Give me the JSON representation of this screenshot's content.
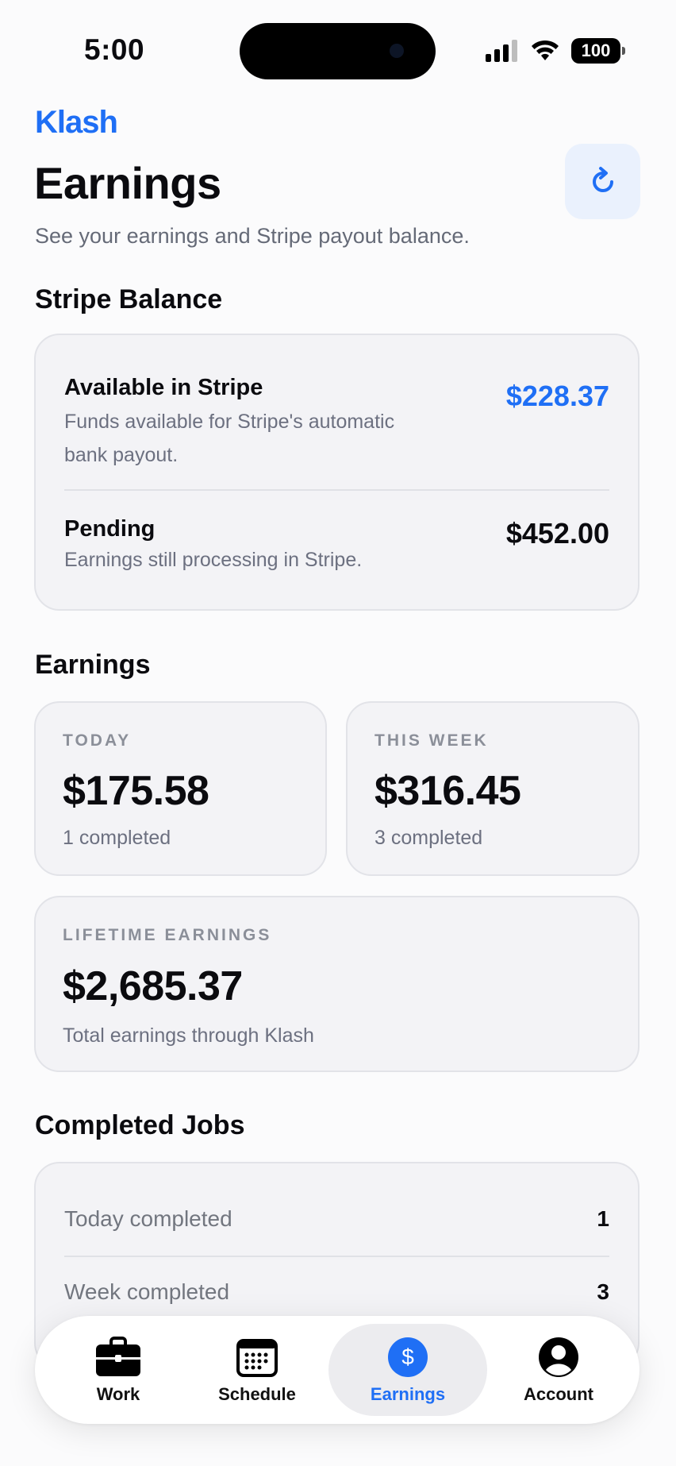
{
  "status_bar": {
    "time": "5:00",
    "battery": "100"
  },
  "header": {
    "brand": "Klash",
    "title": "Earnings",
    "subtitle": "See your earnings and Stripe payout balance.",
    "refresh_icon": "refresh-icon"
  },
  "stripe": {
    "section_title": "Stripe Balance",
    "available": {
      "title": "Available in Stripe",
      "desc_line1": "Funds available for Stripe's automatic",
      "desc_line2": "bank payout.",
      "amount": "$228.37"
    },
    "pending": {
      "title": "Pending",
      "desc": "Earnings still processing in Stripe.",
      "amount": "$452.00"
    }
  },
  "earnings": {
    "section_title": "Earnings",
    "today": {
      "label": "TODAY",
      "amount": "$175.58",
      "meta": "1 completed"
    },
    "week": {
      "label": "THIS WEEK",
      "amount": "$316.45",
      "meta": "3 completed"
    },
    "lifetime": {
      "label": "LIFETIME EARNINGS",
      "amount": "$2,685.37",
      "meta": "Total earnings through Klash"
    }
  },
  "completed_jobs": {
    "section_title": "Completed Jobs",
    "rows": [
      {
        "label": "Today completed",
        "count": "1"
      },
      {
        "label": "Week completed",
        "count": "3"
      }
    ]
  },
  "tab_bar": {
    "tabs": [
      {
        "label": "Work",
        "icon": "briefcase-icon"
      },
      {
        "label": "Schedule",
        "icon": "calendar-icon"
      },
      {
        "label": "Earnings",
        "icon": "dollar-icon",
        "active": true
      },
      {
        "label": "Account",
        "icon": "account-icon"
      }
    ]
  },
  "colors": {
    "accent": "#1f6ff5",
    "text": "#0b0b0f",
    "muted": "#6c7080",
    "card": "#f3f3f6"
  }
}
